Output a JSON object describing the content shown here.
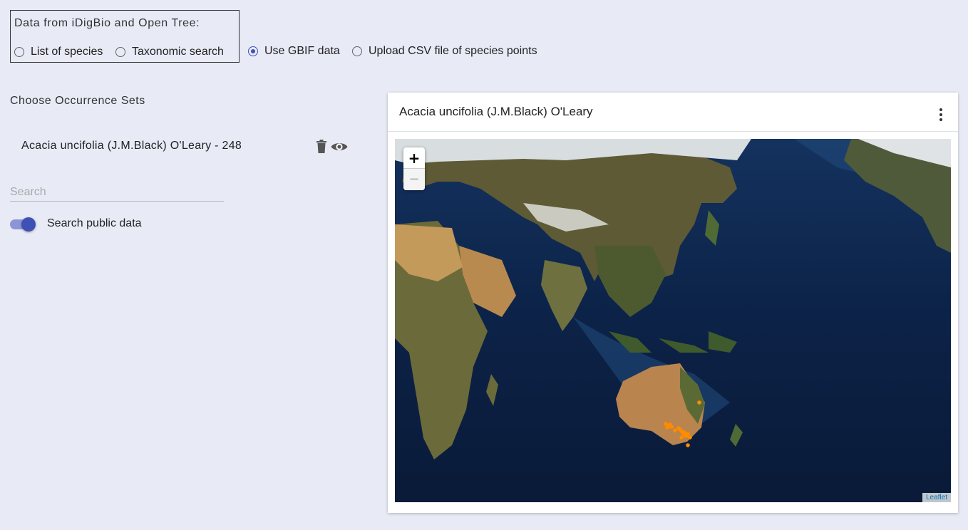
{
  "source_selector": {
    "title": "Data from iDigBio and Open Tree:",
    "options": [
      {
        "label": "List of species",
        "checked": false
      },
      {
        "label": "Taxonomic search",
        "checked": false
      },
      {
        "label": "Use GBIF data",
        "checked": true
      },
      {
        "label": "Upload CSV file of species points",
        "checked": false
      }
    ]
  },
  "occurrence_sets": {
    "title": "Choose Occurrence Sets",
    "items": [
      {
        "label": "Acacia uncifolia (J.M.Black) O'Leary - 248"
      }
    ],
    "search_placeholder": "Search",
    "toggle_label": "Search public data",
    "toggle_on": true
  },
  "map_card": {
    "title": "Acacia uncifolia (J.M.Black) O'Leary",
    "zoom_in": "+",
    "zoom_out": "−",
    "attribution": "Leaflet",
    "marker_color": "#ff8c00"
  },
  "colors": {
    "accent": "#3f51b5",
    "page_bg": "#e8eaf6"
  }
}
